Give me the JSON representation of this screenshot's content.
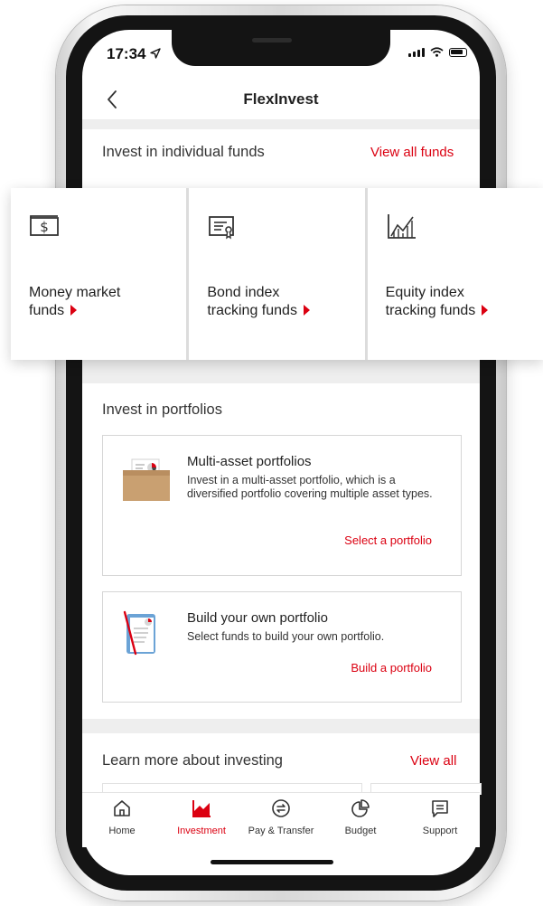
{
  "status_bar": {
    "time": "17:34"
  },
  "header": {
    "title": "FlexInvest"
  },
  "funds_section": {
    "heading": "Invest in individual funds",
    "link": "View all funds",
    "cards": [
      {
        "label_line1": "Money market",
        "label_line2": "funds",
        "icon": "money-icon"
      },
      {
        "label_line1": "Bond index",
        "label_line2": "tracking funds",
        "icon": "bond-certificate-icon"
      },
      {
        "label_line1": "Equity index",
        "label_line2": "tracking funds",
        "icon": "equity-chart-icon"
      }
    ]
  },
  "portfolios_section": {
    "heading": "Invest in portfolios",
    "cards": [
      {
        "title": "Multi-asset portfolios",
        "description": "Invest in a multi-asset portfolio, which is a diversified portfolio covering multiple asset types.",
        "link": "Select a portfolio"
      },
      {
        "title": "Build your own portfolio",
        "description": "Select funds to build your own portfolio.",
        "link": "Build a portfolio"
      }
    ]
  },
  "learn_section": {
    "heading": "Learn more about investing",
    "link": "View all"
  },
  "tabbar": {
    "items": [
      {
        "label": "Home",
        "icon": "home-icon"
      },
      {
        "label": "Investment",
        "icon": "investment-chart-icon",
        "active": true
      },
      {
        "label": "Pay & Transfer",
        "icon": "transfer-icon"
      },
      {
        "label": "Budget",
        "icon": "budget-pie-icon"
      },
      {
        "label": "Support",
        "icon": "chat-icon"
      }
    ]
  },
  "colors": {
    "accent": "#db0011",
    "section_gray": "#eeeeee"
  }
}
